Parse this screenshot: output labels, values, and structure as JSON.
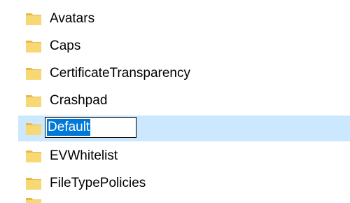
{
  "folders": [
    {
      "name": "Avatars",
      "icon": "folder-icon",
      "selected": false
    },
    {
      "name": "Caps",
      "icon": "folder-icon",
      "selected": false
    },
    {
      "name": "CertificateTransparency",
      "icon": "folder-icon",
      "selected": false
    },
    {
      "name": "Crashpad",
      "icon": "folder-icon",
      "selected": false
    },
    {
      "name": "Default",
      "icon": "folder-icon",
      "selected": true,
      "renaming": true
    },
    {
      "name": "EVWhitelist",
      "icon": "folder-icon",
      "selected": false
    },
    {
      "name": "FileTypePolicies",
      "icon": "folder-icon",
      "selected": false
    }
  ],
  "colors": {
    "selection_background": "#cce8ff",
    "text_highlight": "#0078d7",
    "folder_body": "#f8d775",
    "folder_back": "#e8b84a"
  }
}
